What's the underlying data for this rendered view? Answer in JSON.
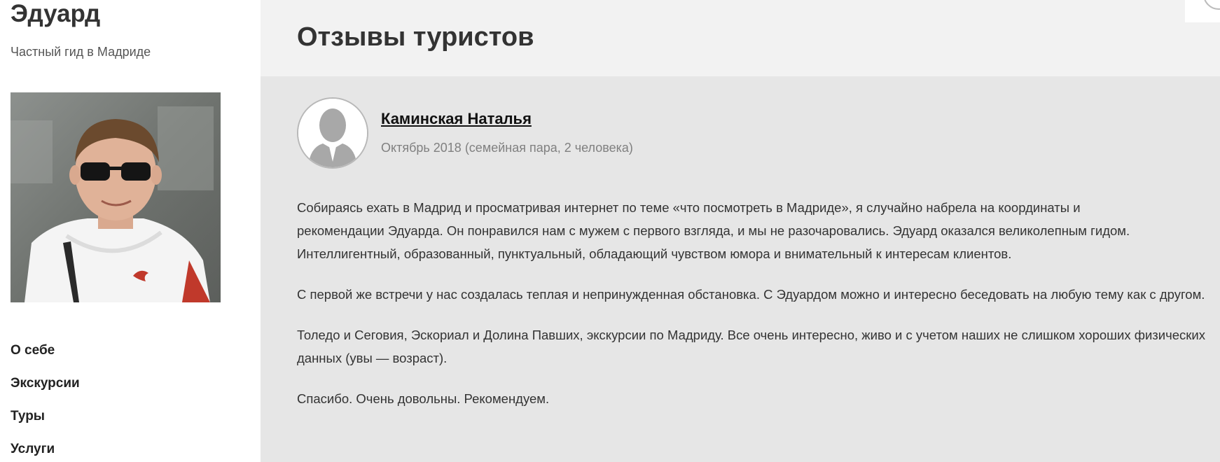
{
  "sidebar": {
    "site_name": "Эдуард",
    "tagline": "Частный гид в Мадриде",
    "nav": [
      {
        "label": "О себе"
      },
      {
        "label": "Экскурсии"
      },
      {
        "label": "Туры"
      },
      {
        "label": "Услуги"
      }
    ]
  },
  "main": {
    "title": "Отзывы туристов",
    "review": {
      "author": "Каминская Наталья",
      "meta": "Октябрь 2018 (семейная пара, 2 человека)",
      "paragraphs": [
        "Собираясь ехать в Мадрид и просматривая интернет по теме «что посмотреть в Мадриде», я случайно набрела на координаты и рекомендации Эдуарда. Он понравился нам с мужем с первого взгляда, и мы не разочаровались. Эдуард оказался великолепным гидом. Интеллигентный, образованный, пунктуальный, обладающий чувством юмора и внимательный к интересам клиентов.",
        "С первой же встречи у нас создалась теплая и непринужденная обстановка. С Эдуардом можно и интересно беседовать на любую тему как с другом.",
        "Толедо и Сеговия, Эскориал и Долина Павших, экскурсии по Мадриду. Все очень интересно, живо и с учетом наших не слишком хороших физических данных (увы — возраст).",
        "Спасибо. Очень довольны. Рекомендуем."
      ]
    }
  },
  "icons": {
    "avatar": "user-silhouette-icon"
  },
  "colors": {
    "main_background": "#e6e6e6",
    "header_background": "#f2f2f2",
    "text": "#333333",
    "meta_text": "#808080"
  }
}
